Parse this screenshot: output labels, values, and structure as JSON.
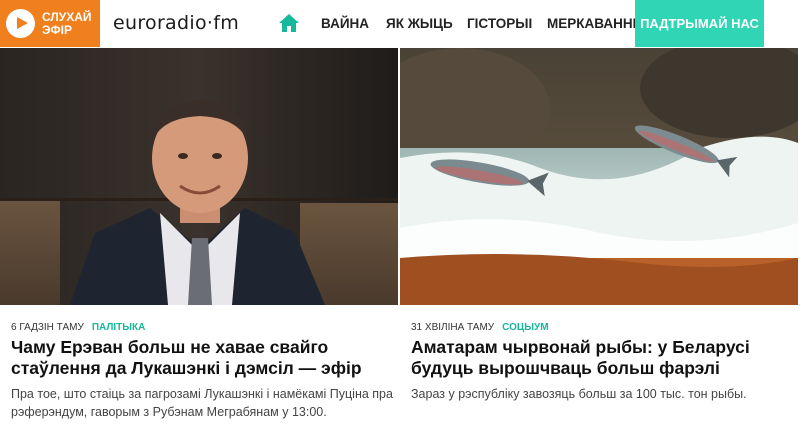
{
  "header": {
    "live_label_1": "Слухай",
    "live_label_2": "эфір",
    "logo_text": "euroradio·fm",
    "nav": [
      "Вайна",
      "Як жыць",
      "Гісторыі",
      "Меркаванні"
    ],
    "support_label": "Падтрымай нас",
    "colors": {
      "live": "#f07f1e",
      "support": "#2fd5b4",
      "home_icon": "#17b99a"
    }
  },
  "articles": [
    {
      "time": "6 гадзін таму",
      "category": "Палітыка",
      "title": "Чаму Ерэван больш не хавае свайго стаўлення да Лукашэнкі і дэмсіл — эфір",
      "lead": "Пра тое, што стаіць за пагрозамі Лукашэнкі і намёкамі Пуціна пра рэферэндум, гаворым з Рубэнам Меграбянам у 13:00."
    },
    {
      "time": "31 хвіліна таму",
      "category": "Соцыум",
      "title": "Аматарам чырвонай рыбы: у Беларусі будуць вырошчваць больш фарэлі",
      "lead": "Зараз у рэспубліку завозяць больш за 100 тыс. тон рыбы."
    }
  ]
}
